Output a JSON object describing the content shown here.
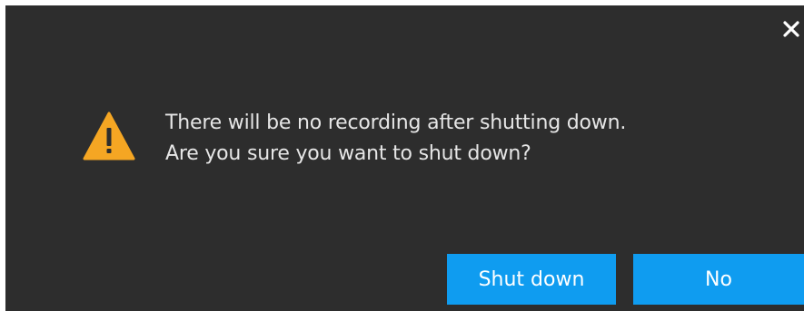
{
  "dialog": {
    "message_line1": "There will be no recording after shutting down.",
    "message_line2": "Are you sure you want to shut down?",
    "icons": {
      "warning": "warning-triangle-icon",
      "close": "close-icon"
    },
    "buttons": {
      "confirm_label": "Shut down",
      "cancel_label": "No"
    },
    "colors": {
      "background": "#2d2d2d",
      "text": "#e6e6e6",
      "warning": "#f5a623",
      "button": "#0f9cf0",
      "button_text": "#ffffff"
    }
  }
}
